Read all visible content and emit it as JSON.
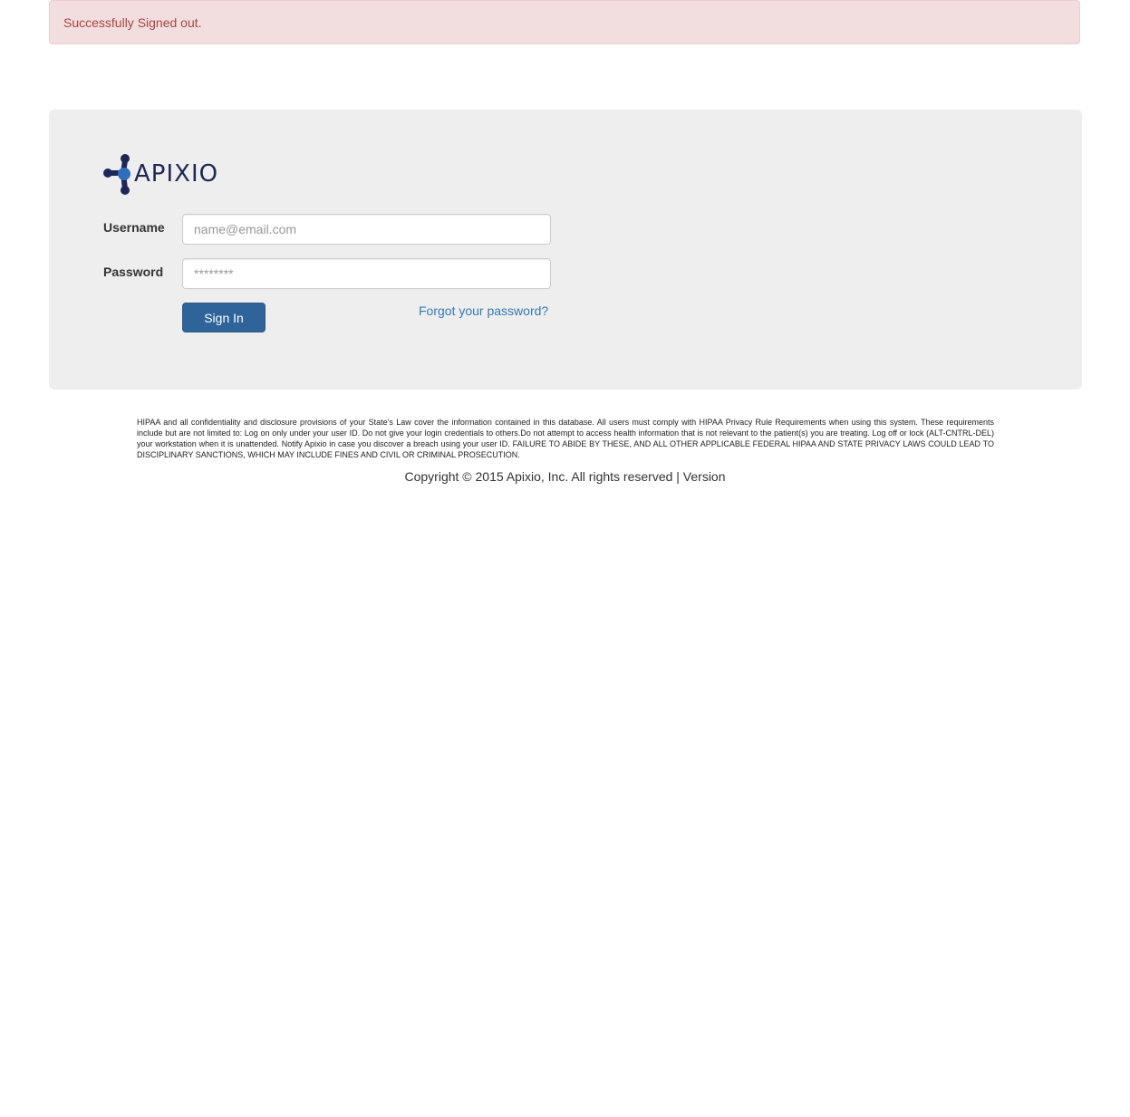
{
  "alert": {
    "message": "Successfully Signed out."
  },
  "brand": {
    "logo_text": "APIXIO",
    "logo_icon": "apixio-molecule-logo",
    "primary_color": "#1f2757",
    "accent_color": "#2f6dbf"
  },
  "login_form": {
    "username_label": "Username",
    "username_placeholder": "name@email.com",
    "username_value": "",
    "password_label": "Password",
    "password_placeholder": "********",
    "password_value": "",
    "submit_label": "Sign In",
    "forgot_link": "Forgot your password?"
  },
  "footer": {
    "disclaimer": "HIPAA and all confidentiality and disclosure provisions of your State's Law cover the information contained in this database. All users must comply with HIPAA Privacy Rule Requirements when using this system. These requirements include but are not limited to: Log on only under your user ID. Do not give your login credentials to others.Do not attempt to access health information that is not relevant to the patient(s) you are treating. Log off or lock (ALT-CNTRL-DEL) your workstation when it is unattended. Notify Apixio in case you discover a breach using your user ID. FAILURE TO ABIDE BY THESE, AND ALL OTHER APPLICABLE FEDERAL HIPAA AND STATE PRIVACY LAWS COULD LEAD TO DISCIPLINARY SANCTIONS, WHICH MAY INCLUDE FINES AND CIVIL OR CRIMINAL PROSECUTION.",
    "copyright": "Copyright © 2015 Apixio, Inc. All rights reserved | Version"
  }
}
